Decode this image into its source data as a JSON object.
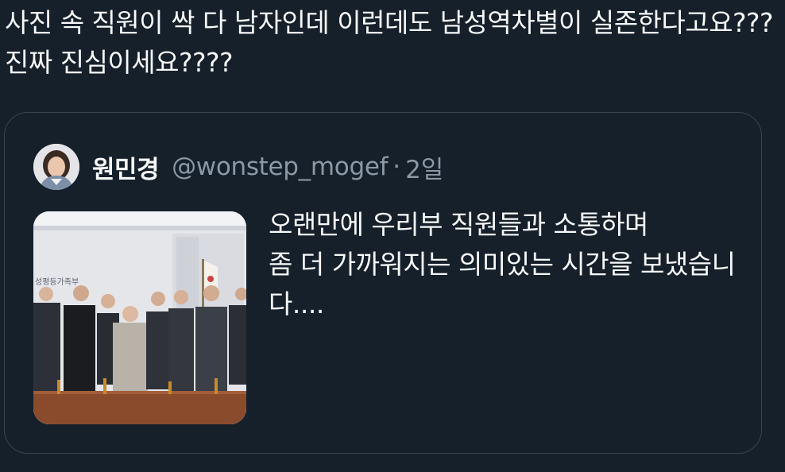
{
  "tweet": {
    "text": "사진 속 직원이 싹 다 남자인데 이런데도 남성역차별이 실존한다고요??? 진짜 진심이세요????"
  },
  "quoted_tweet": {
    "display_name": "원민경",
    "handle": "@wonstep_mogef",
    "separator": "·",
    "time": "2일",
    "body": "오랜만에 우리부 직원들과 소통하며\n좀 더 가까워지는 의미있는 시간을 보냈습니다....",
    "photo": {
      "wall_sign": "성평등가족부"
    }
  },
  "colors": {
    "background": "#15202b",
    "text_primary": "#f7f9f9",
    "text_secondary": "#8b98a5",
    "border": "#38444d"
  },
  "icons": {
    "avatar": "profile-photo",
    "media": "group-photo-thumbnail"
  }
}
